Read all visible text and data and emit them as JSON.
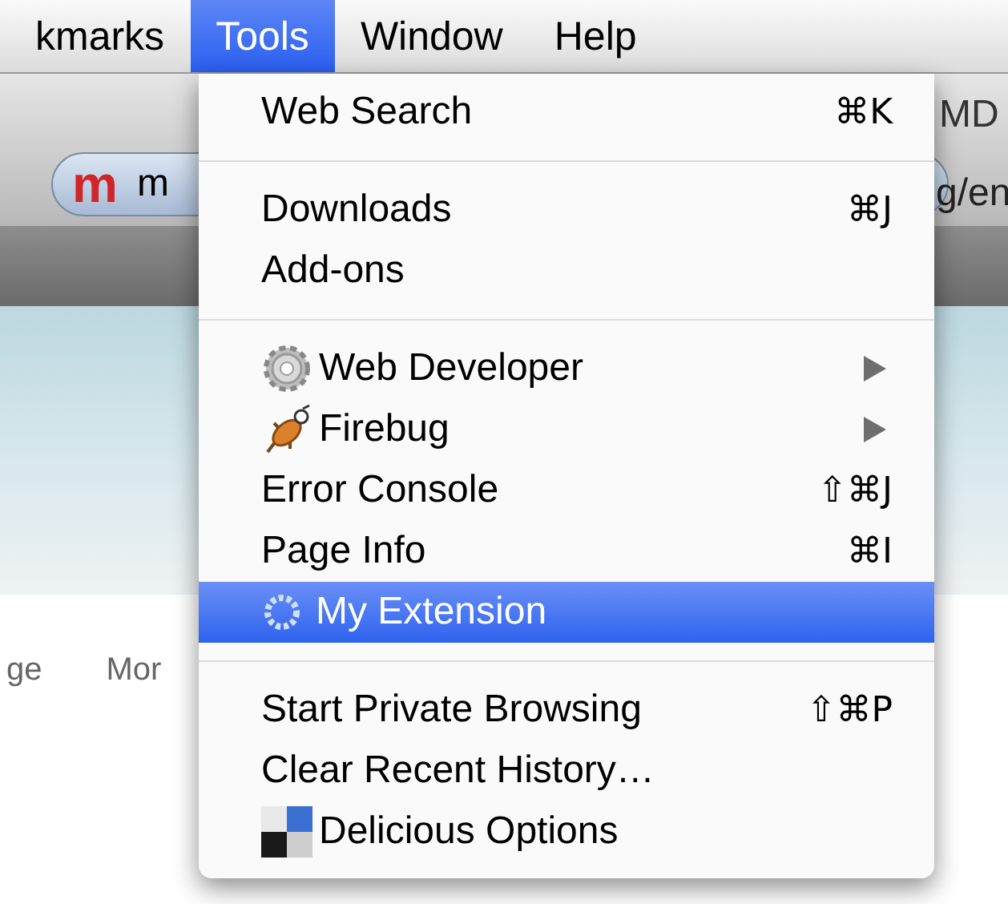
{
  "menubar": [
    {
      "label": "kmarks",
      "selected": false
    },
    {
      "label": "Tools",
      "selected": true
    },
    {
      "label": "Window",
      "selected": false
    },
    {
      "label": "Help",
      "selected": false
    }
  ],
  "toolbar": {
    "logo": "m",
    "url_start": "m",
    "url_end": "g/en",
    "tab_text": "MD"
  },
  "page": {
    "links": [
      "ge",
      "Mor"
    ]
  },
  "menu": {
    "groups": [
      {
        "items": [
          {
            "label": "Web Search",
            "shortcut": "⌘K",
            "selected": false
          }
        ]
      },
      {
        "items": [
          {
            "label": "Downloads",
            "shortcut": "⌘J",
            "selected": false
          },
          {
            "label": "Add-ons",
            "selected": false
          }
        ]
      },
      {
        "items": [
          {
            "label": "Web Developer",
            "kind": "gear",
            "submenu": true,
            "selected": false
          },
          {
            "label": "Firebug",
            "kind": "bug",
            "submenu": true,
            "selected": false
          },
          {
            "label": "Error Console",
            "shortcut": "⇧⌘J",
            "selected": false
          },
          {
            "label": "Page Info",
            "shortcut": "⌘I",
            "selected": false
          },
          {
            "label": "My Extension",
            "kind": "small-gear",
            "selected": true
          }
        ]
      },
      {
        "items": [
          {
            "label": "Start Private Browsing",
            "shortcut": "⇧⌘P",
            "selected": false
          },
          {
            "label": "Clear Recent History…",
            "selected": false
          },
          {
            "label": "Delicious Options",
            "kind": "squares",
            "selected": false
          }
        ]
      }
    ]
  }
}
